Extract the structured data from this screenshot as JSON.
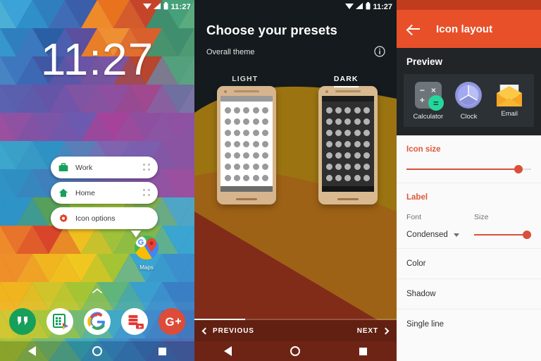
{
  "home": {
    "status": {
      "time": "11:27",
      "icons": [
        "wifi-icon",
        "signal-icon",
        "battery-icon"
      ]
    },
    "clock": "11:27",
    "popup": {
      "items": [
        {
          "label": "Work",
          "icon": "briefcase-icon",
          "color": "#17a05a",
          "handle": "drag-handle-icon"
        },
        {
          "label": "Home",
          "icon": "home-icon",
          "color": "#17a05a",
          "handle": "drag-handle-icon"
        },
        {
          "label": "Icon options",
          "icon": "gear-icon",
          "color": "#e2402b",
          "handle": ""
        }
      ]
    },
    "app": {
      "label": "Maps",
      "icon": "google-maps-icon"
    },
    "dock": [
      {
        "name": "hangouts-icon",
        "color": "#17a05a"
      },
      {
        "name": "play-store-sheets-icon",
        "color": "#ffffff"
      },
      {
        "name": "google-search-icon",
        "color": "#ffffff"
      },
      {
        "name": "youtube-music-icon",
        "color": "#ffffff"
      },
      {
        "name": "google-plus-icon",
        "color": "#dd4b39"
      }
    ],
    "nav": [
      "back-button",
      "home-button",
      "recents-button"
    ]
  },
  "presets": {
    "status": {
      "time": "11:27"
    },
    "title": "Choose your presets",
    "subtitle": "Overall theme",
    "info_icon": "info-icon",
    "tabs": [
      {
        "label": "LIGHT",
        "active": false
      },
      {
        "label": "DARK",
        "active": true
      }
    ],
    "progress_percent": 25,
    "prev_label": "PREVIOUS",
    "next_label": "NEXT"
  },
  "settings": {
    "appbar": {
      "back_icon": "back-arrow-icon",
      "title": "Icon layout"
    },
    "preview": {
      "heading": "Preview",
      "apps": [
        {
          "label": "Calculator",
          "icon": "calculator-icon"
        },
        {
          "label": "Clock",
          "icon": "clock-icon"
        },
        {
          "label": "Email",
          "icon": "email-icon"
        }
      ]
    },
    "icon_size": {
      "title": "Icon size",
      "value_percent": 90
    },
    "label": {
      "title": "Label",
      "font_caption": "Font",
      "font_value": "Condensed",
      "size_caption": "Size",
      "size_percent": 93
    },
    "items": [
      {
        "label": "Color"
      },
      {
        "label": "Shadow"
      },
      {
        "label": "Single line"
      }
    ],
    "accent": "#e0573a"
  }
}
